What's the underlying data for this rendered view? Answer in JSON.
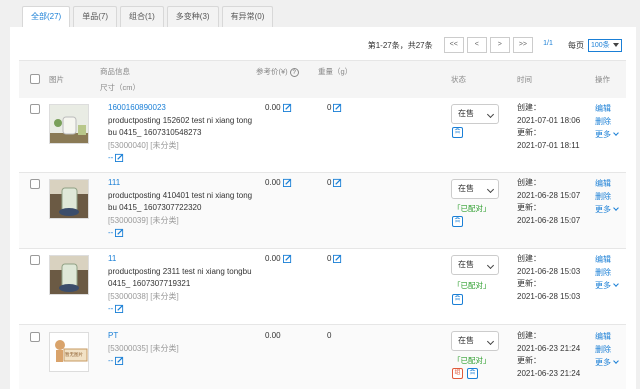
{
  "tabs": [
    {
      "label": "全部(27)",
      "active": true
    },
    {
      "label": "单品(7)"
    },
    {
      "label": "组合(1)"
    },
    {
      "label": "多变种(3)"
    },
    {
      "label": "有异常(0)"
    }
  ],
  "pager": {
    "summary": "第1-27条，共27条",
    "first": "<<",
    "prev": "<",
    "next": ">",
    "last": ">>",
    "page": "1/1",
    "per_page_label": "每页",
    "per_page_value": "100条"
  },
  "headers": {
    "image": "图片",
    "info": "商品信息",
    "size": "尺寸（cm）",
    "price": "参考价(¥)",
    "weight": "重量（g）",
    "status": "状态",
    "time": "时间",
    "ops": "操作"
  },
  "rows": [
    {
      "sku": "1600160890023",
      "desc1": "productposting 152602 test ni xiang tong",
      "desc2": "bu 0415_ 1607310548273",
      "code": "[53000040] [未分类]",
      "dash": "--",
      "price": "0.00",
      "weight": "0",
      "status": "在售",
      "matched": "",
      "badge": "合",
      "created_label": "创建：",
      "created": "2021-07-01 18:06",
      "updated_label": "更新：",
      "updated": "2021-07-01 18:11",
      "op_edit": "编辑",
      "op_delete": "删除",
      "op_more": "更多"
    },
    {
      "sku": "111",
      "desc1": "productposting 410401 test ni xiang tong",
      "desc2": "bu 0415_ 1607307722320",
      "code": "[53000039] [未分类]",
      "dash": "--",
      "price": "0.00",
      "weight": "0",
      "status": "在售",
      "matched": "「已配对」",
      "badge": "合",
      "created_label": "创建：",
      "created": "2021-06-28 15:07",
      "updated_label": "更新：",
      "updated": "2021-06-28 15:07",
      "op_edit": "编辑",
      "op_delete": "删除",
      "op_more": "更多"
    },
    {
      "sku": "11",
      "desc1": "productposting 2311 test ni xiang tongbu",
      "desc2": "0415_ 1607307719321",
      "code": "[53000038] [未分类]",
      "dash": "--",
      "price": "0.00",
      "weight": "0",
      "status": "在售",
      "matched": "「已配对」",
      "badge": "合",
      "created_label": "创建：",
      "created": "2021-06-28 15:03",
      "updated_label": "更新：",
      "updated": "2021-06-28 15:03",
      "op_edit": "编辑",
      "op_delete": "删除",
      "op_more": "更多"
    },
    {
      "sku": "PT",
      "code": "[53000035] [未分类]",
      "dash": "--",
      "price": "0.00",
      "weight": "0",
      "status": "在售",
      "matched": "「已配对」",
      "badge_red": "组",
      "badge": "合",
      "no_image_label": "暂无图片",
      "created_label": "创建：",
      "created": "2021-06-23 21:24",
      "updated_label": "更新：",
      "updated": "2021-06-23 21:24",
      "op_edit": "编辑",
      "op_delete": "删除",
      "op_more": "更多"
    }
  ],
  "colors": {
    "link": "#1a7fd6",
    "matched": "#2a9d2a",
    "badge_red": "#e05a3a"
  }
}
